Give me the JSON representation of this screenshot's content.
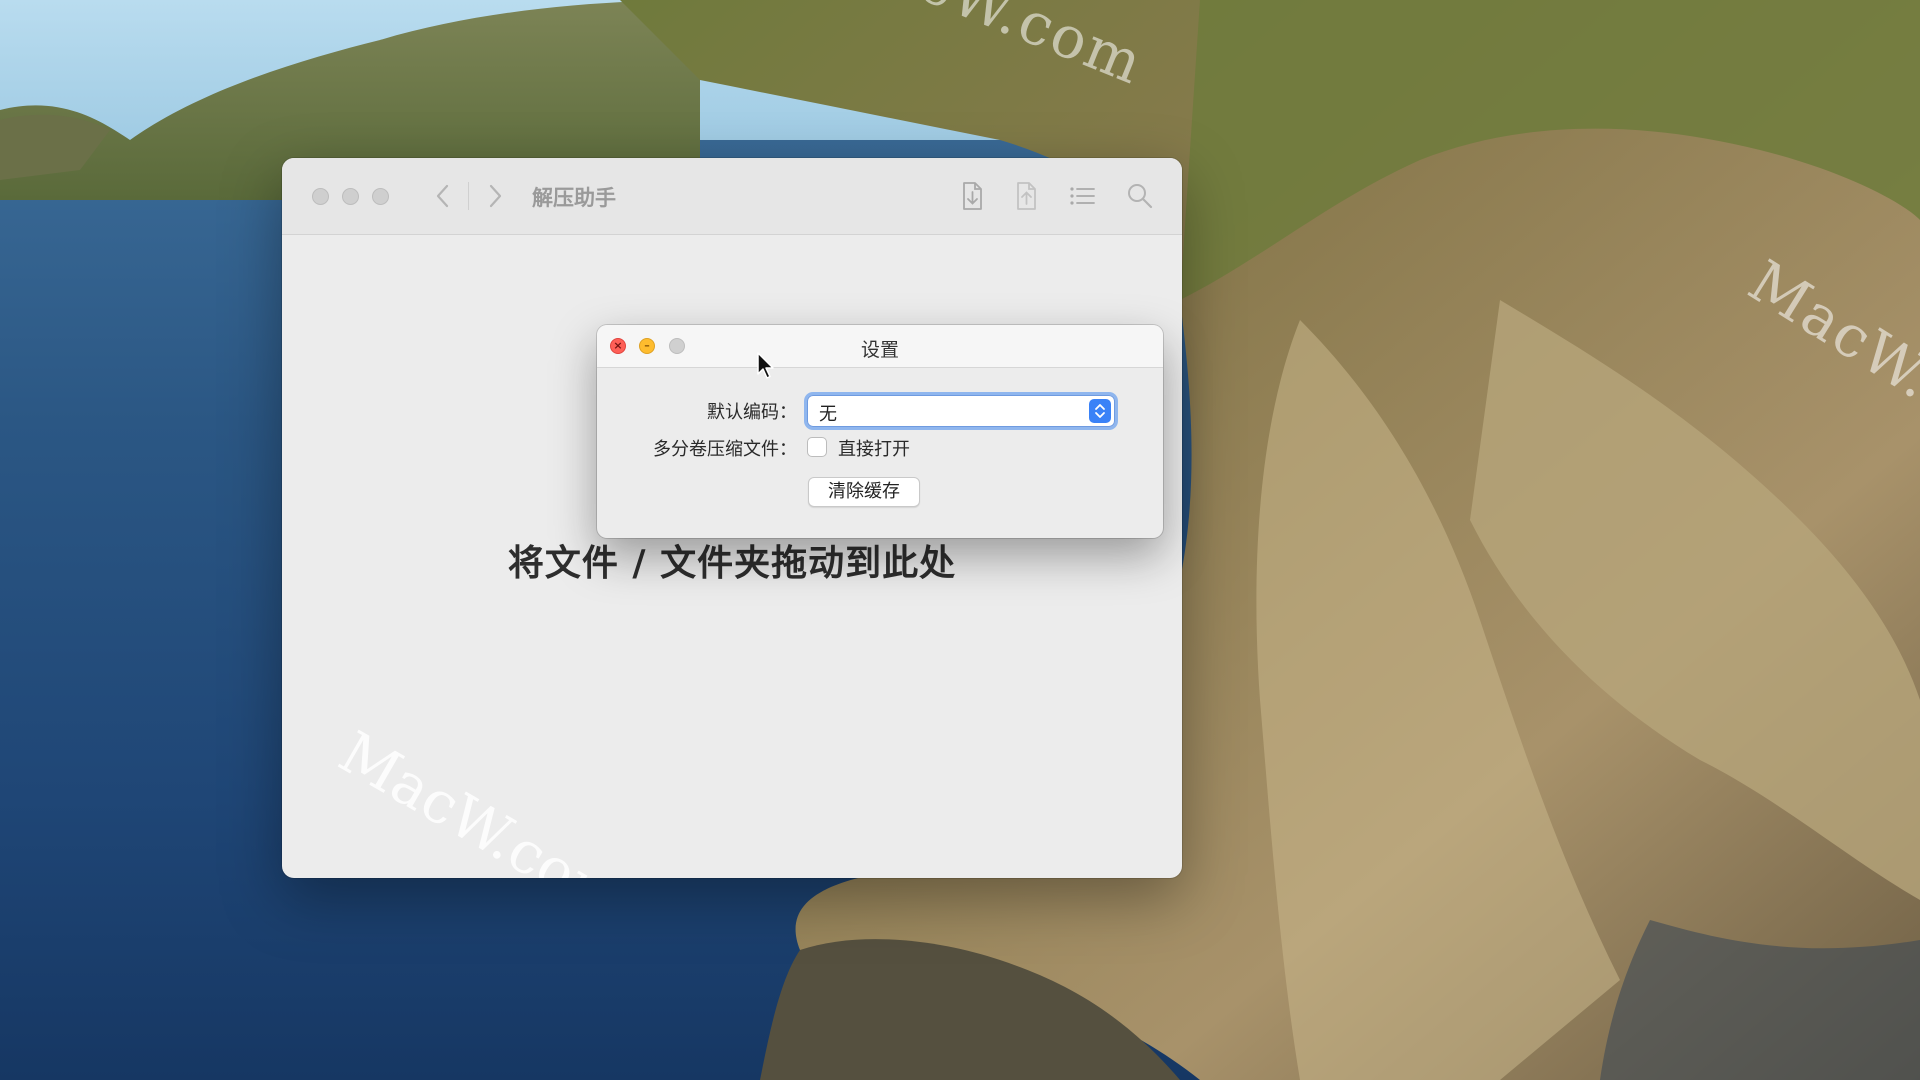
{
  "desktop": {
    "watermark_text": "MacW.com"
  },
  "main_window": {
    "title": "解压助手",
    "nav_back": "‹",
    "nav_forward": "›",
    "drop_hint": "将文件 / 文件夹拖动到此处",
    "toolbar_icons": [
      "extract-icon",
      "compress-icon",
      "list-icon",
      "search-icon"
    ]
  },
  "settings_dialog": {
    "title": "设置",
    "encoding_label": "默认编码：",
    "encoding_value": "无",
    "multivolume_label": "多分卷压缩文件：",
    "open_directly_label": "直接打开",
    "open_directly_checked": false,
    "clear_cache_button": "清除缓存"
  },
  "colors": {
    "accent": "#3a82f7",
    "close": "#fe5f57",
    "minimize": "#febc2e"
  }
}
